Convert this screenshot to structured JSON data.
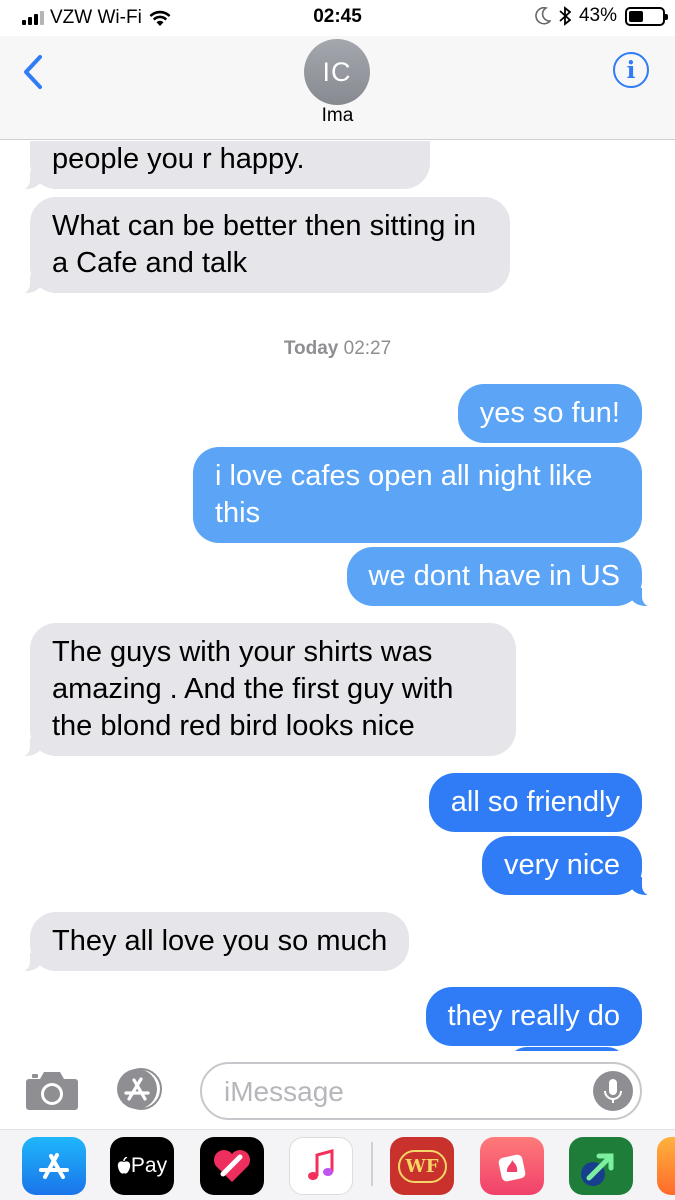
{
  "status_bar": {
    "carrier": "VZW Wi-Fi",
    "time": "02:45",
    "battery_percent": "43%",
    "battery_level": 0.43,
    "icons": [
      "signal-icon",
      "wifi-icon",
      "moon-icon",
      "bluetooth-icon",
      "battery-icon"
    ]
  },
  "header": {
    "back_icon": "chevron-left-icon",
    "avatar_initials": "IC",
    "contact_name": "Ima",
    "info_icon": "info-icon",
    "info_glyph": "i"
  },
  "thread": {
    "timestamp_day": "Today",
    "timestamp_time": "02:27",
    "messages": [
      {
        "from": "them",
        "text": "people you r happy."
      },
      {
        "from": "them",
        "text": "What can be better then sitting in a Cafe and talk"
      },
      {
        "from": "me",
        "text": "yes so fun!"
      },
      {
        "from": "me",
        "text": "i love cafes open all night like this"
      },
      {
        "from": "me",
        "text": "we dont have in US"
      },
      {
        "from": "them",
        "text": "The guys with your shirts was amazing . And the first guy with the blond red bird looks nice"
      },
      {
        "from": "me",
        "text": "all so friendly"
      },
      {
        "from": "me",
        "text": "very nice"
      },
      {
        "from": "them",
        "text": "They all love you so much"
      },
      {
        "from": "me",
        "text": "they really do"
      }
    ]
  },
  "input_bar": {
    "placeholder": "iMessage",
    "icons": [
      "camera-icon",
      "app-store-icon",
      "microphone-icon"
    ]
  },
  "app_drawer": {
    "apps": [
      {
        "name": "app-store-icon",
        "label": ""
      },
      {
        "name": "apple-pay-icon",
        "label": "Pay"
      },
      {
        "name": "digital-touch-icon",
        "label": ""
      },
      {
        "name": "music-icon",
        "label": ""
      },
      {
        "name": "wf-app-icon",
        "label": "WF"
      },
      {
        "name": "photo-app-icon",
        "label": ""
      },
      {
        "name": "arrow-app-icon",
        "label": ""
      },
      {
        "name": "partial-app-icon",
        "label": ""
      }
    ]
  },
  "colors": {
    "outgoing_bubble": "#2f7cf6",
    "outgoing_bubble_light": "#5ba4f6",
    "incoming_bubble": "#e5e5ea",
    "accent": "#2f7cf6",
    "timestamp": "#8e8e93"
  }
}
